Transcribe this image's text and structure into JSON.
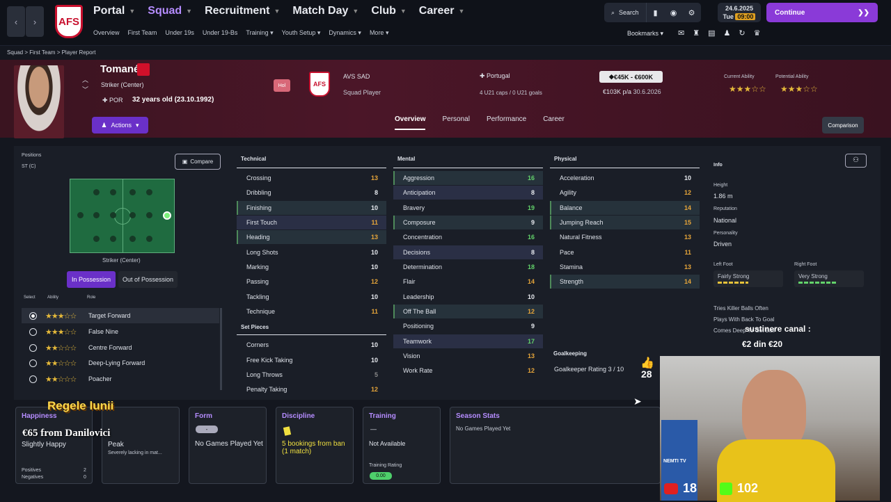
{
  "nav": {
    "back": "‹",
    "forward": "›",
    "main": [
      {
        "label": "Portal",
        "active": false
      },
      {
        "label": "Squad",
        "active": true
      },
      {
        "label": "Recruitment",
        "active": false
      },
      {
        "label": "Match Day",
        "active": false
      },
      {
        "label": "Club",
        "active": false
      },
      {
        "label": "Career",
        "active": false
      }
    ],
    "sub": [
      "Overview",
      "First Team",
      "Under 19s",
      "Under 19-Bs",
      "Training",
      "Youth Setup",
      "Dynamics",
      "More"
    ],
    "search": "Search",
    "date": "24.6.2025",
    "day": "Tue",
    "time": "09:00",
    "continue": "Continue",
    "bookmarks": "Bookmarks",
    "logo_text": "AFS"
  },
  "breadcrumb": [
    "Squad",
    "First Team",
    "Player Report"
  ],
  "player": {
    "name": "Tomané",
    "position": "Striker (Center)",
    "nation": "POR",
    "age": "32 years old (23.10.1992)",
    "actions": "Actions",
    "hol": "Hol",
    "club": "AVS SAD",
    "club_logo": "AFS",
    "squad_status": "Squad Player",
    "country": "Portugal",
    "caps": "4 U21 caps / 0 U21 goals",
    "value": "€45K - €600K",
    "wage": "€103K p/a",
    "contract": "30.6.2026",
    "current_ability_label": "Current Ability",
    "potential_ability_label": "Potential Ability",
    "current_ability_stars": "★★★☆☆",
    "potential_ability_stars": "★★★☆☆"
  },
  "tabs": [
    "Overview",
    "Personal",
    "Performance",
    "Career"
  ],
  "comparison": "Comparison",
  "positions": {
    "label": "Positions",
    "value": "ST (C)",
    "compare": "Compare",
    "role_name": "Striker (Center)",
    "in_possession": "In Possession",
    "out_of_possession": "Out of Possession",
    "headers": [
      "Select",
      "Ability",
      "Role"
    ],
    "roles": [
      {
        "stars": "★★★☆☆",
        "name": "Target Forward",
        "selected": true
      },
      {
        "stars": "★★★☆☆",
        "name": "False Nine",
        "selected": false
      },
      {
        "stars": "★★☆☆☆",
        "name": "Centre Forward",
        "selected": false
      },
      {
        "stars": "★★☆☆☆",
        "name": "Deep-Lying Forward",
        "selected": false
      },
      {
        "stars": "★★☆☆☆",
        "name": "Poacher",
        "selected": false
      }
    ]
  },
  "technical": {
    "title": "Technical",
    "items": [
      [
        "Crossing",
        "13",
        "y",
        ""
      ],
      [
        "Dribbling",
        "8",
        "w",
        ""
      ],
      [
        "Finishing",
        "10",
        "w",
        "hl"
      ],
      [
        "First Touch",
        "11",
        "y",
        "hl2"
      ],
      [
        "Heading",
        "13",
        "y",
        "hl"
      ],
      [
        "Long Shots",
        "10",
        "w",
        ""
      ],
      [
        "Marking",
        "10",
        "w",
        ""
      ],
      [
        "Passing",
        "12",
        "y",
        ""
      ],
      [
        "Tackling",
        "10",
        "w",
        ""
      ],
      [
        "Technique",
        "11",
        "y",
        ""
      ]
    ]
  },
  "setpieces": {
    "title": "Set Pieces",
    "items": [
      [
        "Corners",
        "10",
        "w",
        ""
      ],
      [
        "Free Kick Taking",
        "10",
        "w",
        ""
      ],
      [
        "Long Throws",
        "5",
        "d",
        ""
      ],
      [
        "Penalty Taking",
        "12",
        "y",
        ""
      ]
    ]
  },
  "mental": {
    "title": "Mental",
    "items": [
      [
        "Aggression",
        "16",
        "g",
        "hl"
      ],
      [
        "Anticipation",
        "8",
        "w",
        "hl2"
      ],
      [
        "Bravery",
        "19",
        "g",
        ""
      ],
      [
        "Composure",
        "9",
        "w",
        "hl"
      ],
      [
        "Concentration",
        "16",
        "g",
        ""
      ],
      [
        "Decisions",
        "8",
        "w",
        "hl2"
      ],
      [
        "Determination",
        "18",
        "g",
        ""
      ],
      [
        "Flair",
        "14",
        "y",
        ""
      ],
      [
        "Leadership",
        "10",
        "w",
        ""
      ],
      [
        "Off The Ball",
        "12",
        "y",
        "hl"
      ],
      [
        "Positioning",
        "9",
        "w",
        ""
      ],
      [
        "Teamwork",
        "17",
        "g",
        "hl2"
      ],
      [
        "Vision",
        "13",
        "y",
        ""
      ],
      [
        "Work Rate",
        "12",
        "y",
        ""
      ]
    ]
  },
  "physical": {
    "title": "Physical",
    "items": [
      [
        "Acceleration",
        "10",
        "w",
        ""
      ],
      [
        "Agility",
        "12",
        "y",
        ""
      ],
      [
        "Balance",
        "14",
        "y",
        "hl"
      ],
      [
        "Jumping Reach",
        "15",
        "y",
        "hl"
      ],
      [
        "Natural Fitness",
        "13",
        "y",
        ""
      ],
      [
        "Pace",
        "11",
        "y",
        ""
      ],
      [
        "Stamina",
        "13",
        "y",
        ""
      ],
      [
        "Strength",
        "14",
        "y",
        "hl"
      ]
    ]
  },
  "goalkeeping": {
    "title": "Goalkeeping",
    "rating": "Goalkeeper Rating",
    "value": "3 / 10"
  },
  "info": {
    "title": "Info",
    "height_label": "Height",
    "height": "1.86 m",
    "rep_label": "Reputation",
    "rep": "National",
    "pers_label": "Personality",
    "pers": "Driven",
    "lf_label": "Left Foot",
    "lf": "Fairly Strong",
    "rf_label": "Right Foot",
    "rf": "Very Strong",
    "traits": [
      "Tries Killer Balls Often",
      "Plays With Back To Goal",
      "Comes Deep To Get Ball"
    ]
  },
  "cards": {
    "happiness": {
      "title": "Happiness",
      "value": "Slightly Happy",
      "pos_label": "Positives",
      "pos": "2",
      "neg_label": "Negatives",
      "neg": "0"
    },
    "condition": {
      "value": "Peak",
      "sub": "Severely lacking in mat..."
    },
    "form": {
      "title": "Form",
      "badge": "-",
      "value": "No Games Played Yet"
    },
    "discipline": {
      "title": "Discipline",
      "value": "5 bookings from ban (1 match)"
    },
    "training": {
      "title": "Training",
      "dash": "—",
      "value": "Not Available",
      "rating_label": "Training Rating",
      "rating": "0.00"
    },
    "season": {
      "title": "Season Stats",
      "value": "No Games Played Yet"
    }
  },
  "overlay": {
    "likes": "28",
    "support": "sustinere canal :",
    "support_amount": "€2 din €20",
    "king": "Regele lunii",
    "donation": "€65 from Danilovici",
    "yt": "18",
    "kick": "102",
    "cam_label": "NEMTI TV"
  },
  "colors": {
    "accent": "#8a3ad8",
    "header": "#4b1628",
    "green": "#63d36b",
    "yellow": "#e6a53a"
  }
}
